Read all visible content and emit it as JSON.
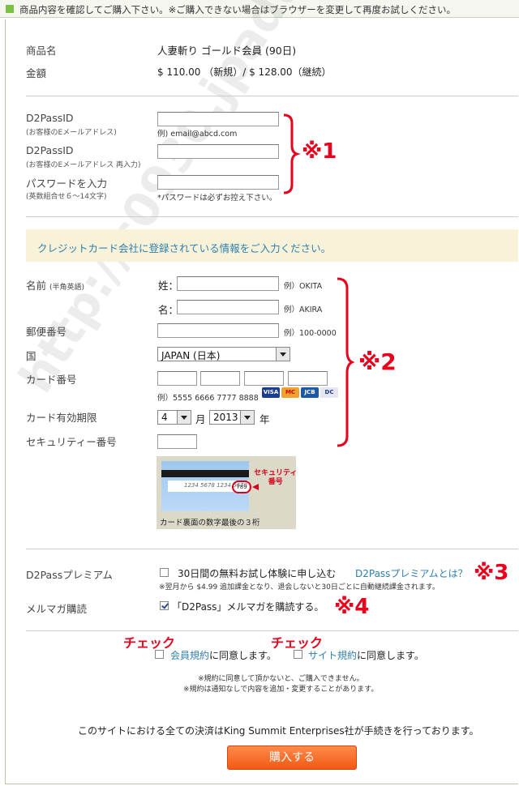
{
  "top_notice": "商品内容を確認してご購入下さい。※ご購入できない場合はブラウザーを変更して再度お試しください。",
  "product": {
    "name_label": "商品名",
    "name_value": "人妻斬り ゴールド会員 (90日)",
    "price_label": "金額",
    "price_value": "$ 110.00 （新規）/ $ 128.00（継続）"
  },
  "account": {
    "id_label": "D2PassID",
    "id_sub": "(お客様のEメールアドレス)",
    "id_hint": "例) email@abcd.com",
    "id_confirm_label": "D2PassID",
    "id_confirm_sub": "(お客様のEメールアドレス 再入力)",
    "password_label": "パスワードを入力",
    "password_sub": "(英数組合せ６～14文字)",
    "password_hint": "*パスワードは必ずお控え下さい。"
  },
  "card_banner": "クレジットカード会社に登録されている情報をご入力ください。",
  "card_form": {
    "name_label": "名前",
    "name_sub": "(半角英語)",
    "last_label": "姓：",
    "last_hint": "例）OKITA",
    "first_label": "名：",
    "first_hint": "例）AKIRA",
    "zip_label": "郵便番号",
    "zip_hint": "例）100-0000",
    "country_label": "国",
    "country_value": "JAPAN (日本)",
    "card_number_label": "カード番号",
    "card_number_hint": "例）5555 6666 7777 8888",
    "card_brands": [
      "VISA",
      "MC",
      "JCB",
      "DC"
    ],
    "expiry_label": "カード有効期限",
    "month_value": "4",
    "month_unit": "月",
    "year_value": "2013",
    "year_unit": "年",
    "security_label": "セキュリティー番号",
    "card_image": {
      "sample_number": "1234 5678 1234 5678",
      "code": "789",
      "marker_label_1": "セキュリティ",
      "marker_label_2": "番号",
      "caption": "カード裏面の数字最後の３桁"
    }
  },
  "options": {
    "premium_label": "D2Passプレミアム",
    "premium_text": "30日間の無料お試し体験に申し込む",
    "premium_link": "D2Passプレミアムとは？",
    "premium_note": "※翌月から $4.99 追加課金となり、退会しないと30日ごとに自動継続課金されます。",
    "premium_checked": false,
    "mail_label": "メルマガ購読",
    "mail_text": "「D2Pass」メルマガを購読する。",
    "mail_checked": true
  },
  "agreements": {
    "check_mark_1": "チェック",
    "check_mark_2": "チェック",
    "member_link": "会員規約",
    "member_suffix": "に同意します。",
    "site_link": "サイト規約",
    "site_suffix": "に同意します。",
    "note_1": "※規約に同意して頂かないと、ご購入できません。",
    "note_2": "※規約は通知なしで内容を追加・変更することがあります。"
  },
  "footer_text": "このサイトにおける全ての決済はKing Summit Enterprises社が手続きを行っております。",
  "purchase_button": "購入する",
  "annotations": {
    "mark_1": "※1",
    "mark_2": "※2",
    "mark_3": "※3",
    "mark_4": "※4"
  },
  "watermark": "http://c0930.jpadult.com",
  "colors": {
    "accent_red": "#e8001c",
    "link_blue": "#2f7fb0",
    "button_orange": "#f26a1f",
    "banner_bg": "#f8f3d8"
  }
}
